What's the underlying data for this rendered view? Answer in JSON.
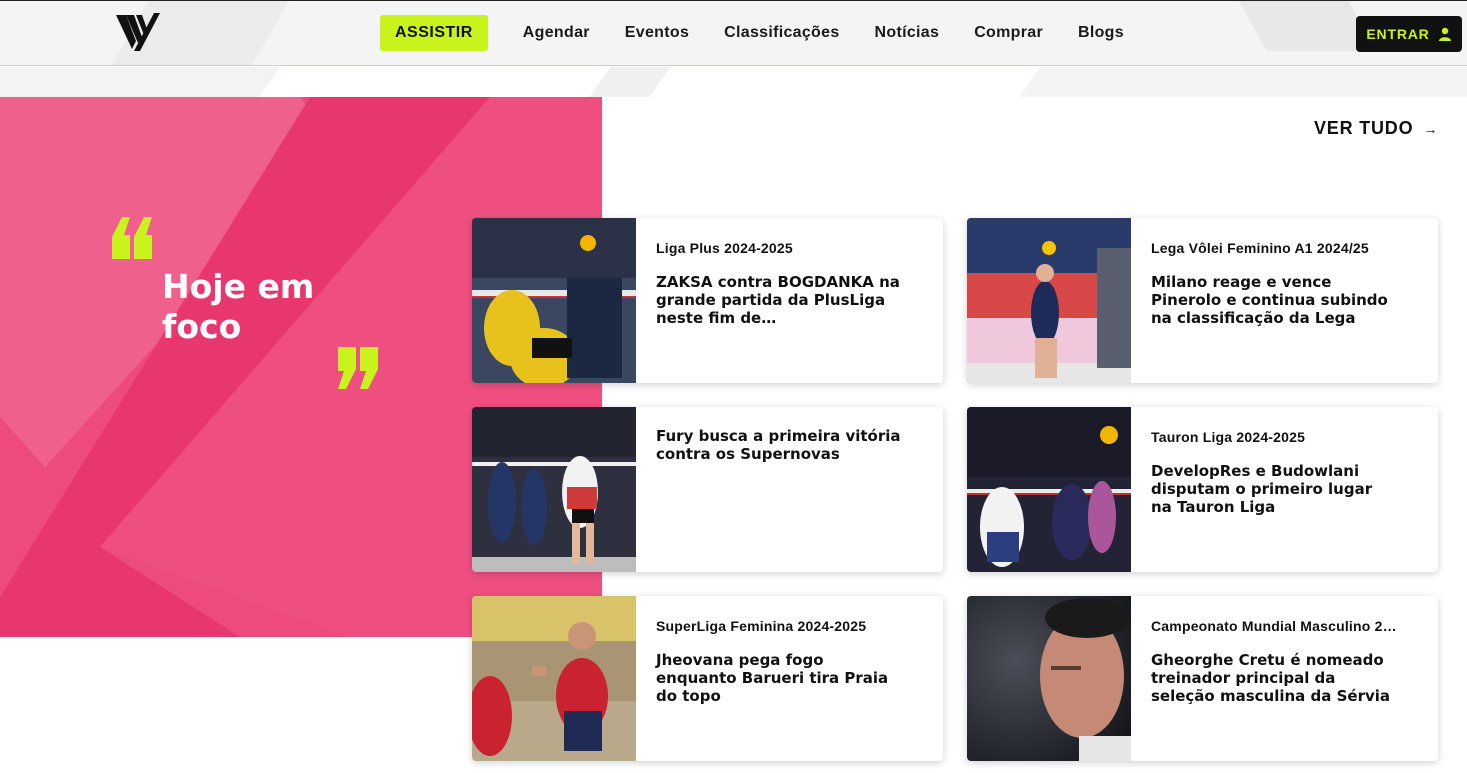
{
  "header": {
    "watch_label": "ASSISTIR",
    "nav": [
      "Agendar",
      "Eventos",
      "Classificações",
      "Notícias",
      "Comprar",
      "Blogs"
    ],
    "login_label": "ENTRAR"
  },
  "feature": {
    "headline": "Hoje em foco",
    "see_all": "VER TUDO"
  },
  "colors": {
    "accent": "#c9f31d",
    "pink": "#ed4a7d",
    "dark": "#111111"
  },
  "cards": [
    {
      "category": "Liga Plus 2024-2025",
      "title": "ZAKSA contra BOGDANKA na grande partida da PlusLiga neste fim de…"
    },
    {
      "category": "Lega Vôlei Feminino A1 2024/25",
      "title": "Milano reage e vence Pinerolo e continua subindo na classificação da Lega"
    },
    {
      "category": "",
      "title": "Fury busca a primeira vitória contra os Supernovas"
    },
    {
      "category": "Tauron Liga 2024-2025",
      "title": "DevelopRes e Budowlani disputam o primeiro lugar na Tauron Liga"
    },
    {
      "category": "SuperLiga Feminina 2024-2025",
      "title": "Jheovana pega fogo enquanto Barueri tira Praia do topo"
    },
    {
      "category": "Campeonato Mundial Masculino 2…",
      "title": "Gheorghe Cretu é nomeado treinador principal da seleção masculina da Sérvia"
    }
  ],
  "icons": {
    "logo": "vnl-logo-icon",
    "login": "user-icon",
    "see_all": "arrow-right-icon",
    "quotes": "quote-mark-icon"
  }
}
